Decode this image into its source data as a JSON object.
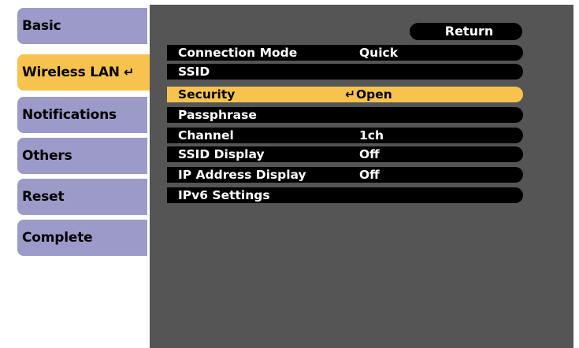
{
  "sidebar": {
    "tabs": [
      {
        "label": "Basic"
      },
      {
        "label": "Wireless LAN",
        "glyph": "↵"
      },
      {
        "label": "Notifications"
      },
      {
        "label": "Others"
      },
      {
        "label": "Reset"
      },
      {
        "label": "Complete"
      }
    ]
  },
  "menu": {
    "return_label": "Return",
    "rows": [
      {
        "label": "Connection Mode",
        "value": "Quick"
      },
      {
        "label": "SSID",
        "value": ""
      },
      {
        "label": "Security",
        "value": "Open",
        "glyph": "↵"
      },
      {
        "label": "Passphrase",
        "value": ""
      },
      {
        "label": "Channel",
        "value": "1ch"
      },
      {
        "label": "SSID Display",
        "value": "Off"
      },
      {
        "label": "IP Address Display",
        "value": "Off"
      },
      {
        "label": "IPv6 Settings",
        "value": ""
      }
    ]
  },
  "colors": {
    "panel": "#555555",
    "tab": "#9c9ac8",
    "highlight": "#f7c34e",
    "row": "#000000"
  },
  "icons": {
    "enter": "enter-arrow-icon"
  }
}
